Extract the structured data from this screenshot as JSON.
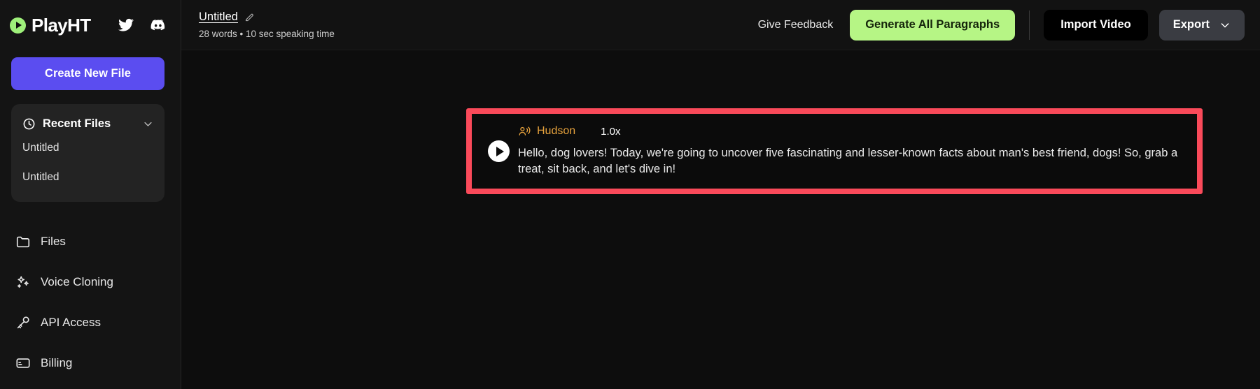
{
  "brand": {
    "name": "PlayHT",
    "logo_icon": "play-circle-icon",
    "accent_green": "#9ef07a",
    "socials": [
      {
        "icon": "twitter-icon",
        "label": "Twitter"
      },
      {
        "icon": "discord-icon",
        "label": "Discord"
      }
    ]
  },
  "sidebar": {
    "create_button": "Create New File",
    "create_button_color": "#5b4df0",
    "recent": {
      "icon": "clock-icon",
      "title": "Recent Files",
      "chevron": "chevron-down-icon",
      "items": [
        {
          "label": "Untitled"
        },
        {
          "label": "Untitled"
        }
      ]
    },
    "nav": [
      {
        "icon": "folder-icon",
        "label": "Files"
      },
      {
        "icon": "sparkles-icon",
        "label": "Voice Cloning"
      },
      {
        "icon": "key-icon",
        "label": "API Access"
      },
      {
        "icon": "credit-card-icon",
        "label": "Billing"
      }
    ]
  },
  "topbar": {
    "doc_title": "Untitled",
    "edit_icon": "edit-pencil-icon",
    "doc_stats": "28 words • 10 sec speaking time",
    "feedback_label": "Give Feedback",
    "generate_label": "Generate All Paragraphs",
    "generate_color": "#b6f585",
    "import_label": "Import Video",
    "export_label": "Export",
    "export_chevron": "chevron-down-icon"
  },
  "paragraph": {
    "play_icon": "play-button-icon",
    "voice_icon": "voice-speaker-icon",
    "voice_name": "Hudson",
    "voice_color": "#e8a33d",
    "speed": "1.0x",
    "text": "Hello, dog lovers! Today, we're going to uncover five fascinating and lesser-known facts about man's best friend, dogs! So, grab a treat, sit back, and let's dive in!",
    "highlight_color": "#fa4a5a"
  }
}
